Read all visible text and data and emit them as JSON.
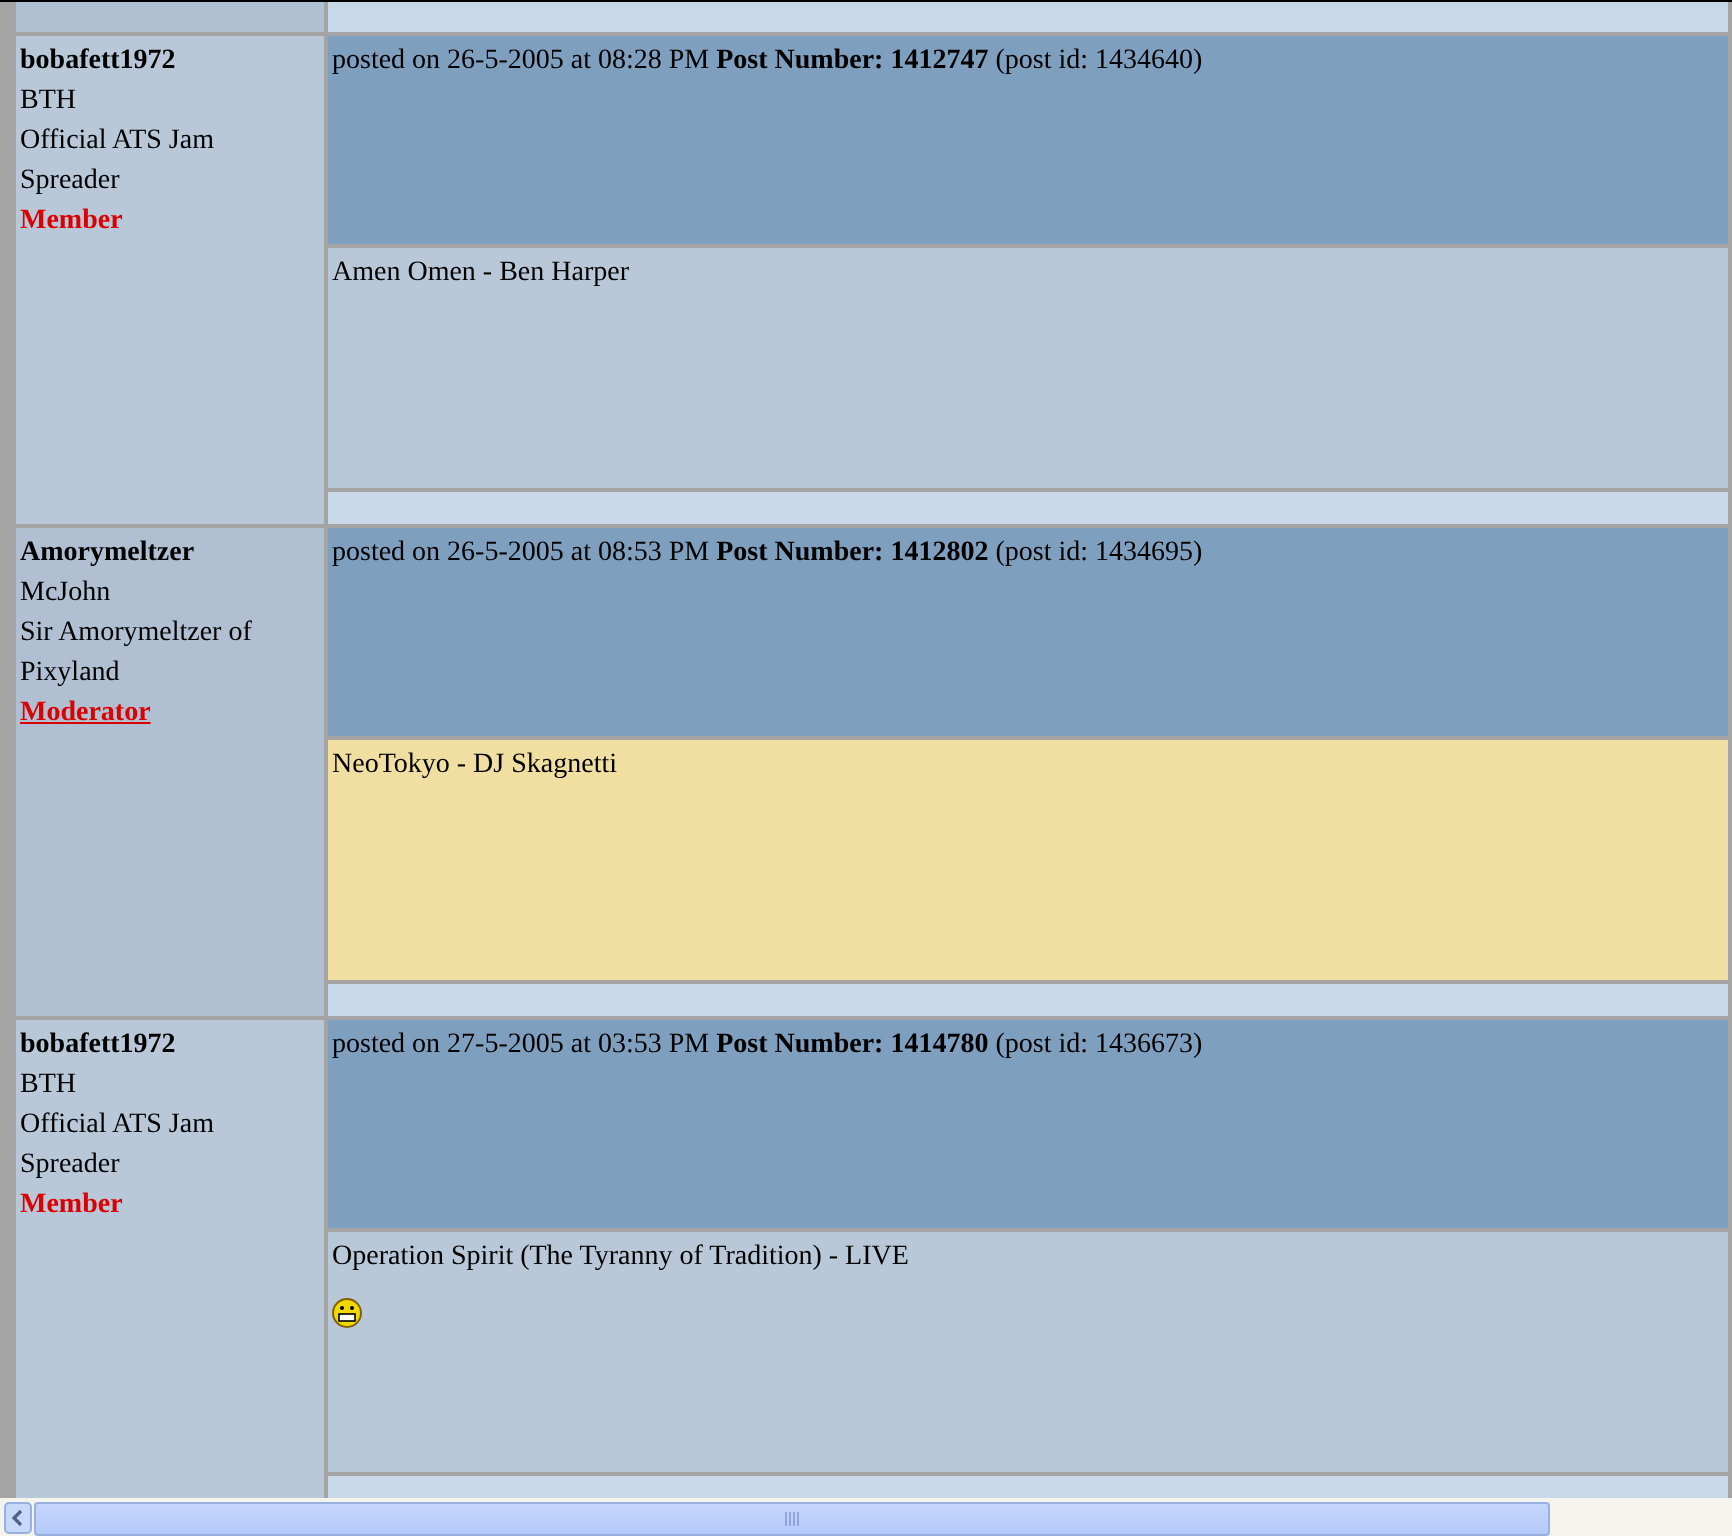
{
  "posts": [
    {
      "author": "bobafett1972",
      "user_lines": [
        "BTH",
        "Official ATS Jam",
        "Spreader"
      ],
      "rank": "Member",
      "kind": "member",
      "header": "posted on 26-5-2005 at 08:28 PM **Post Number: 1412747** (post id: 1434640)",
      "body": "Amen Omen - Ben Harper",
      "highlighted": false,
      "smiley": false
    },
    {
      "author": "Amorymeltzer",
      "user_lines": [
        "McJohn",
        "Sir Amorymeltzer of",
        "Pixyland"
      ],
      "rank": "Moderator",
      "kind": "moderator",
      "header": "posted on 26-5-2005 at 08:53 PM **Post Number: 1412802** (post id: 1434695)",
      "body": "NeoTokyo - DJ Skagnetti",
      "highlighted": true,
      "smiley": false
    },
    {
      "author": "bobafett1972",
      "user_lines": [
        "BTH",
        "Official ATS Jam",
        "Spreader"
      ],
      "rank": "Member",
      "kind": "member",
      "header": "posted on 27-5-2005 at 03:53 PM **Post Number: 1414780** (post id: 1436673)",
      "body": "Operation Spirit (The Tyranny of Tradition) - LIVE",
      "highlighted": false,
      "smiley": true
    }
  ]
}
